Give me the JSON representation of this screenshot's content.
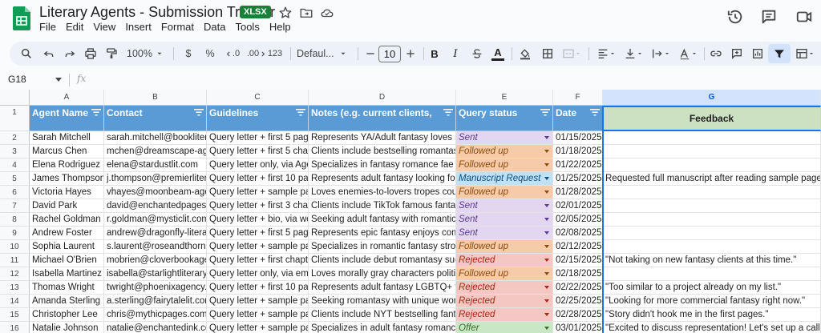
{
  "app": {
    "title": "Literary Agents - Submission Tracker",
    "file_badge": "XLSX"
  },
  "menu": [
    "File",
    "Edit",
    "View",
    "Insert",
    "Format",
    "Data",
    "Tools",
    "Help"
  ],
  "toolbar": {
    "zoom": "100%",
    "currency": "$",
    "percent": "%",
    "decimals_decrease": ".0",
    "decimals_increase": ".00",
    "number_format": "123",
    "font_family": "Defaul...",
    "font_size": "10",
    "bold": "B",
    "italic": "I",
    "text_color_letter": "A"
  },
  "formula_bar": {
    "cell_ref": "G18",
    "fx": "fx",
    "value": ""
  },
  "columns": [
    "A",
    "B",
    "C",
    "D",
    "E",
    "F",
    "G"
  ],
  "selected_column": "G",
  "headers": [
    "Agent Name",
    "Contact",
    "Guidelines",
    "Notes (e.g. current clients,",
    "Query status",
    "Date",
    "Feedback"
  ],
  "status_colors": {
    "Sent": {
      "bg": "#e2d6f0",
      "fg": "#5b3a8e"
    },
    "Followed up": {
      "bg": "#f6cba9",
      "fg": "#8a4b0e"
    },
    "Manuscript Request": {
      "bg": "#bfe1f6",
      "fg": "#0b4f80"
    },
    "Rejected": {
      "bg": "#f4c7c3",
      "fg": "#a52714"
    },
    "Offer": {
      "bg": "#c9e7c4",
      "fg": "#3a6b2b"
    }
  },
  "rows": [
    {
      "num": "1"
    },
    {
      "num": "2",
      "agent": "Sarah Mitchell",
      "contact": "sarah.mitchell@booklitera",
      "guidelines": "Query letter + first 5 page",
      "notes": "Represents YA/Adult fantasy loves str",
      "status": "Sent",
      "date": "01/15/2025",
      "feedback": ""
    },
    {
      "num": "3",
      "agent": "Marcus Chen",
      "contact": "mchen@dreamscape-age",
      "guidelines": "Query letter + first 5 chapte",
      "notes": "Clients include bestselling romantasy",
      "status": "Followed up",
      "date": "01/18/2025",
      "feedback": ""
    },
    {
      "num": "4",
      "agent": "Elena Rodriguez",
      "contact": "elena@stardustlit.com",
      "guidelines": "Query letter only, via Agen",
      "notes": "Specializes in fantasy romance fae st",
      "status": "Followed up",
      "date": "01/22/2025",
      "feedback": ""
    },
    {
      "num": "5",
      "agent": "James Thompson",
      "contact": "j.thompson@premierlitera",
      "guidelines": "Query letter + first 10 pag",
      "notes": "Represents adult fantasy looking for d",
      "status": "Manuscript Request",
      "date": "01/25/2025",
      "feedback": "Requested full manuscript after reading sample pages."
    },
    {
      "num": "6",
      "agent": "Victoria Hayes",
      "contact": "vhayes@moonbeam-agen",
      "guidelines": "Query letter + sample pag",
      "notes": "Loves enemies-to-lovers tropes court",
      "status": "Followed up",
      "date": "01/28/2025",
      "feedback": ""
    },
    {
      "num": "7",
      "agent": "David Park",
      "contact": "david@enchantedpages.c",
      "guidelines": "Query letter + first 3 chap",
      "notes": "Clients include TikTok famous fantasy",
      "status": "Sent",
      "date": "02/01/2025",
      "feedback": ""
    },
    {
      "num": "8",
      "agent": "Rachel Goldman",
      "contact": "r.goldman@mysticlit.com",
      "guidelines": "Query letter + bio, via web",
      "notes": "Seeking adult fantasy with romantic e",
      "status": "Sent",
      "date": "02/05/2025",
      "feedback": ""
    },
    {
      "num": "9",
      "agent": "Andrew Foster",
      "contact": "andrew@dragonfly-literar",
      "guidelines": "Query letter + first 5 page",
      "notes": "Represents epic fantasy enjoys comp",
      "status": "Sent",
      "date": "02/08/2025",
      "feedback": ""
    },
    {
      "num": "10",
      "agent": "Sophia Laurent",
      "contact": "s.laurent@roseandthorna",
      "guidelines": "Query letter + sample pag",
      "notes": "Specializes in romantic fantasy strong",
      "status": "Followed up",
      "date": "02/12/2025",
      "feedback": ""
    },
    {
      "num": "11",
      "agent": "Michael O'Brien",
      "contact": "mobrien@cloverbookager",
      "guidelines": "Query letter + first chapte",
      "notes": "Clients include debut romantasy succ",
      "status": "Rejected",
      "date": "02/15/2025",
      "feedback": "\"Not taking on new fantasy clients at this time.\""
    },
    {
      "num": "12",
      "agent": "Isabella Martinez",
      "contact": "isabella@starlightliterary.",
      "guidelines": "Query letter only, via ema",
      "notes": "Loves morally gray characters politica",
      "status": "Followed up",
      "date": "02/18/2025",
      "feedback": ""
    },
    {
      "num": "13",
      "agent": "Thomas Wright",
      "contact": "twright@phoenixagency.c",
      "guidelines": "Query letter + first 10 pag",
      "notes": "Represents adult fantasy LGBTQ+ frie",
      "status": "Rejected",
      "date": "02/22/2025",
      "feedback": "\"Too similar to a project already on my list.\""
    },
    {
      "num": "14",
      "agent": "Amanda Sterling",
      "contact": "a.sterling@fairytalelit.com",
      "guidelines": "Query letter + sample pag",
      "notes": "Seeking romantasy with unique world",
      "status": "Rejected",
      "date": "02/25/2025",
      "feedback": "\"Looking for more commercial fantasy right now.\""
    },
    {
      "num": "15",
      "agent": "Christopher Lee",
      "contact": "chris@mythicpages.com",
      "guidelines": "Query letter + sample pag",
      "notes": "Clients include NYT bestselling fantas",
      "status": "Rejected",
      "date": "02/28/2025",
      "feedback": "\"Story didn't hook me in the first pages.\""
    },
    {
      "num": "16",
      "agent": "Natalie Johnson",
      "contact": "natalie@enchantedink.co",
      "guidelines": "Query letter + sample pag",
      "notes": "Specializes in adult fantasy romance",
      "status": "Offer",
      "date": "03/01/2025",
      "feedback": "\"Excited to discuss representation! Let's set up a call.\""
    }
  ]
}
